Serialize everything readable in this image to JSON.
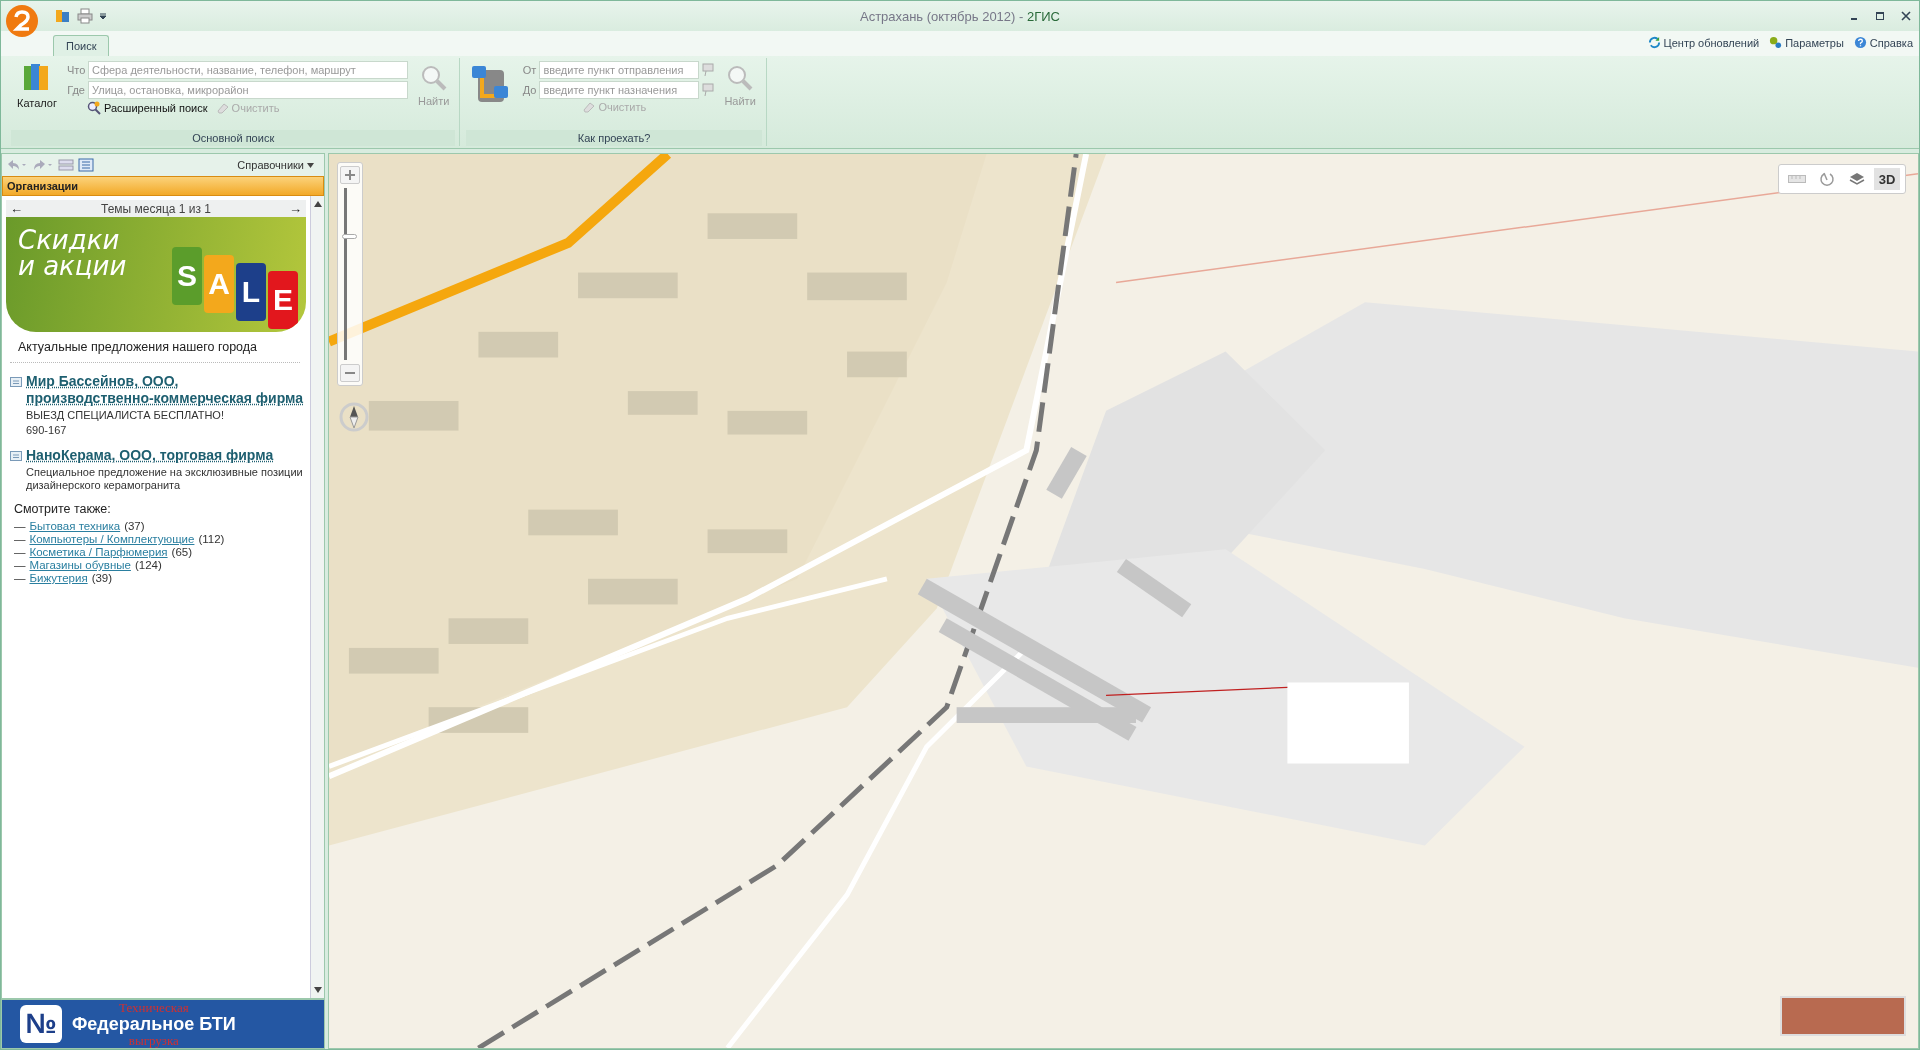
{
  "window": {
    "title": "Астрахань (октябрь 2012)",
    "separator": "-",
    "app_name": "2ГИС"
  },
  "quick_links": [
    {
      "kind": "update",
      "label": "Центр обновлений"
    },
    {
      "kind": "settings",
      "label": "Параметры"
    },
    {
      "kind": "help",
      "label": "Справка"
    }
  ],
  "tabs": [
    {
      "label": "Поиск",
      "selected": true
    }
  ],
  "main_search": {
    "catalog_label": "Каталог",
    "what_label": "Что",
    "what_placeholder": "Сфера деятельности, название, телефон, маршрут",
    "where_label": "Где",
    "where_placeholder": "Улица, остановка, микрорайон",
    "find": {
      "label": "Найти",
      "disabled": true
    },
    "advanced_label": "Расширенный поиск",
    "clear": {
      "label": "Очистить",
      "disabled": true
    },
    "caption": "Основной поиск"
  },
  "route_search": {
    "from_label": "От",
    "from_placeholder": "введите пункт отправления",
    "to_label": "До",
    "to_placeholder": "введите пункт назначения",
    "clear": {
      "label": "Очистить",
      "disabled": true
    },
    "find": {
      "label": "Найти",
      "disabled": true
    },
    "caption": "Как проехать?"
  },
  "sidebar": {
    "dropdown_label": "Справочники",
    "section_title": "Организации",
    "pager": {
      "prev": "←",
      "label": "Темы месяца 1 из 1",
      "next": "→"
    },
    "promo_banner": {
      "line_1": "Скидки",
      "line_2": "и акции",
      "tags": [
        {
          "letter": "S",
          "color": "#5b9d2b"
        },
        {
          "letter": "A",
          "color": "#f3a81c"
        },
        {
          "letter": "L",
          "color": "#1d3f8a"
        },
        {
          "letter": "E",
          "color": "#e2171d"
        }
      ]
    },
    "tagline": "Актуальные предложения нашего города",
    "organizations": [
      {
        "name": "Мир Бассейнов, ООО, производственно-коммерческая фирма",
        "description": [
          "ВЫЕЗД СПЕЦИАЛИСТА БЕСПЛАТНО!",
          "690-167"
        ]
      },
      {
        "name": "НаноКерама, ООО, торговая фирма",
        "description": [
          "Специальное предложение на эксклюзивные позиции дизайнерского керамогранита"
        ]
      }
    ],
    "see_also_title": "Смотрите также:",
    "see_also": [
      {
        "marker": "—",
        "label": "Бытовая техника",
        "count": "(37)"
      },
      {
        "marker": "—",
        "label": "Компьютеры / Комплектующие",
        "count": "(112)"
      },
      {
        "marker": "—",
        "label": "Косметика / Парфюмерия",
        "count": "(65)"
      },
      {
        "marker": "—",
        "label": "Магазины обувные",
        "count": "(124)"
      },
      {
        "marker": "—",
        "label": "Бижутерия",
        "count": "(39)"
      }
    ],
    "bottom_banner": {
      "logo_glyph": "№",
      "top_line": "Техническая",
      "main_line": "Федеральное БТИ",
      "bottom_line": "выгрузка"
    }
  },
  "map": {
    "zoom": {
      "level": 0.72
    },
    "tools": [
      {
        "kind": "ruler",
        "selected": false
      },
      {
        "kind": "radius",
        "selected": false
      },
      {
        "kind": "layers",
        "selected": false
      },
      {
        "kind": "mode",
        "label": "3D",
        "selected": true
      }
    ]
  }
}
